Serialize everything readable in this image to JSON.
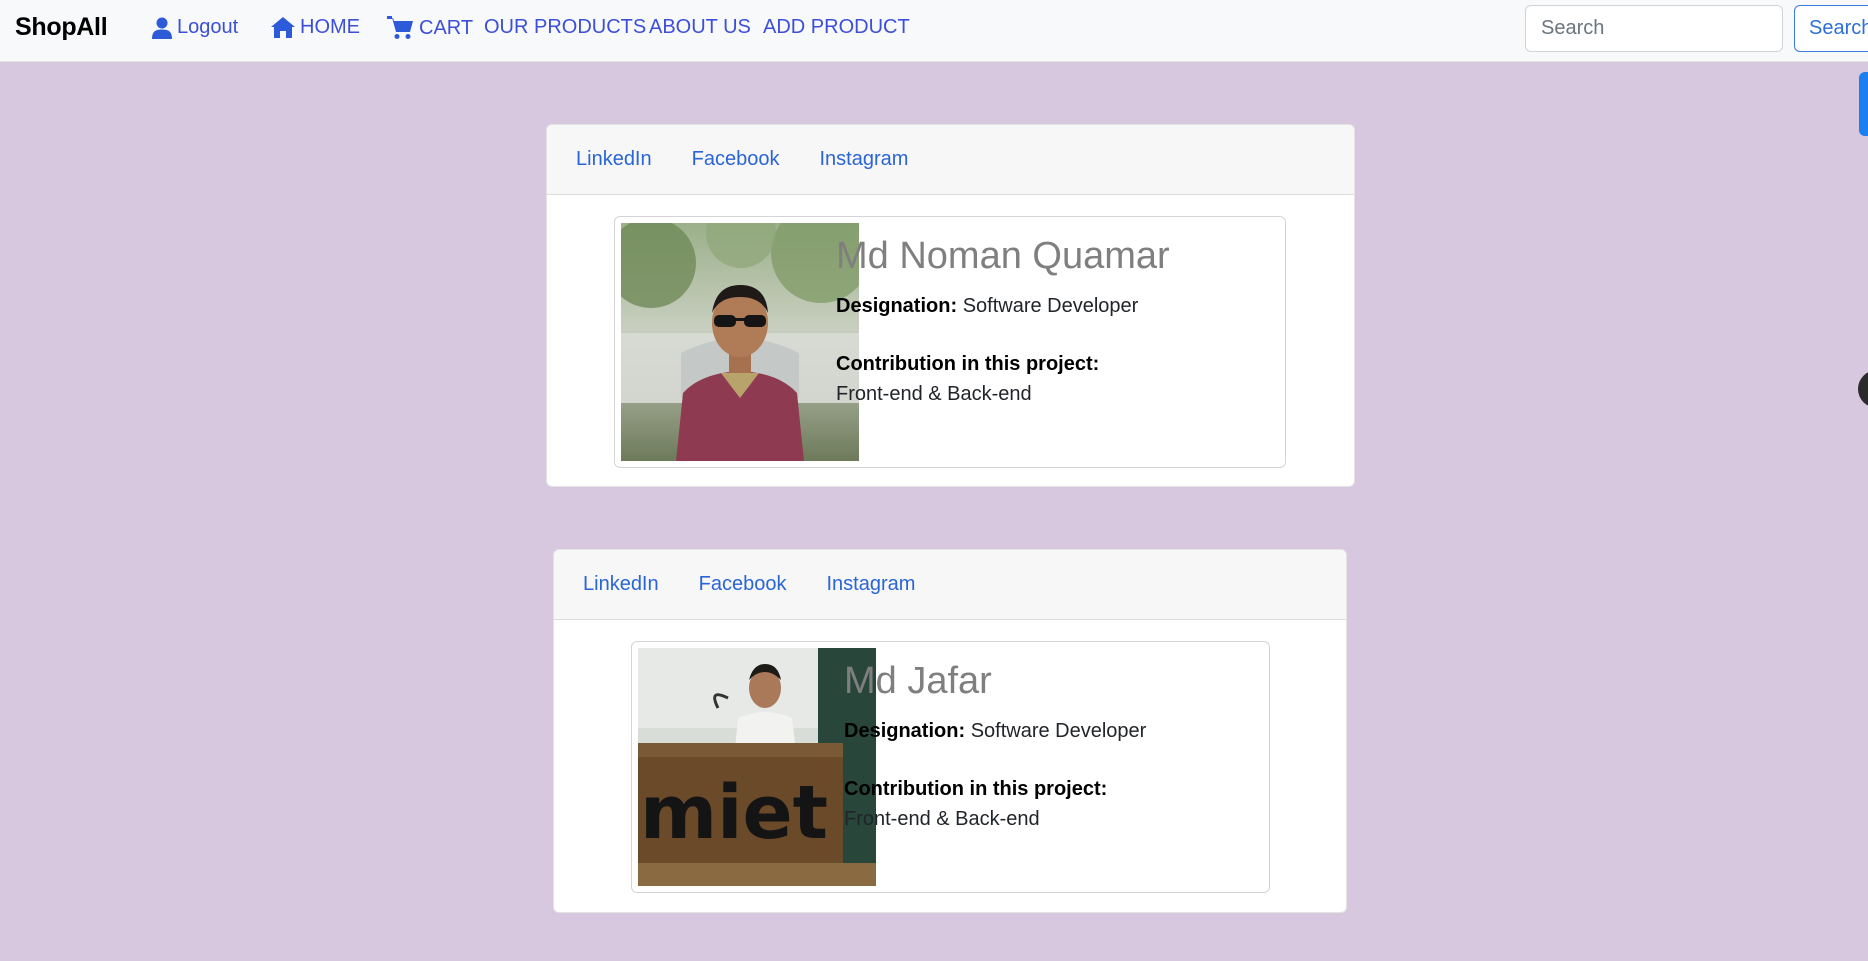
{
  "brand": "ShopAll",
  "nav": {
    "logout": "Logout",
    "home": "HOME",
    "cart": "CART",
    "products": "OUR PRODUCTS",
    "about": "ABOUT US",
    "add_product": "ADD PRODUCT"
  },
  "search": {
    "placeholder": "Search",
    "button_label": "Search"
  },
  "team": [
    {
      "social": [
        "LinkedIn",
        "Facebook",
        "Instagram"
      ],
      "name": "Md Noman Quamar",
      "designation_label": "Designation:",
      "designation": "Software Developer",
      "contribution_label": "Contribution in this project:",
      "contribution": "Front-end & Back-end"
    },
    {
      "social": [
        "LinkedIn",
        "Facebook",
        "Instagram"
      ],
      "name": "Md Jafar",
      "designation_label": "Designation:",
      "designation": "Software Developer",
      "contribution_label": "Contribution in this project:",
      "contribution": "Front-end & Back-end",
      "photo_text": "miet"
    }
  ],
  "colors": {
    "background": "#d7c7df",
    "link": "#2a65d6",
    "nav_link": "#3d4fd8"
  }
}
